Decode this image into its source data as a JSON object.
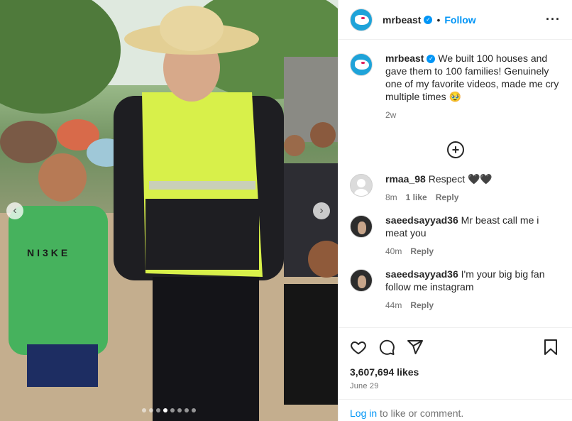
{
  "post": {
    "author": "mrbeast",
    "follow_label": "Follow",
    "bullet": "•",
    "caption": "We built 100 houses and gave them to 100 families! Genuinely one of my favorite videos, made me cry multiple times 🥹",
    "caption_age": "2w",
    "likes": "3,607,694 likes",
    "date": "June 29",
    "shirt_text": "NI3KE",
    "carousel": {
      "total_slides": 8,
      "active_index": 3
    }
  },
  "comments": [
    {
      "user": "rmaa_98",
      "text": "Respect 🖤🖤",
      "age": "8m",
      "likes": "1 like",
      "reply": "Reply",
      "avatar": "default"
    },
    {
      "user": "saeedsayyad36",
      "text": "Mr beast call me i meat you",
      "age": "40m",
      "likes": "",
      "reply": "Reply",
      "avatar": "photo"
    },
    {
      "user": "saeedsayyad36",
      "text": "I'm your big big fan follow me instagram",
      "age": "44m",
      "likes": "",
      "reply": "Reply",
      "avatar": "photo"
    }
  ],
  "footer": {
    "login_link": "Log in",
    "login_text": " to like or comment."
  },
  "icons": {
    "more": "more-options-icon",
    "load_more": "plus-circle-icon",
    "like": "heart-icon",
    "comment": "comment-icon",
    "share": "share-icon",
    "save": "bookmark-icon",
    "next": "chevron-right-icon",
    "prev": "chevron-left-icon"
  },
  "colors": {
    "link": "#0095f6",
    "verified": "#0095f6",
    "muted": "#737373",
    "vest": "#d8f04a"
  }
}
